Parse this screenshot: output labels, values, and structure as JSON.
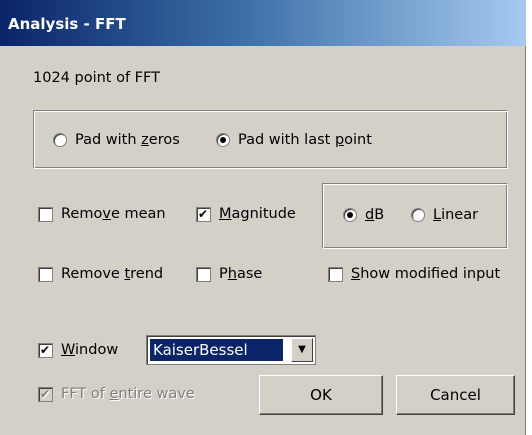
{
  "window": {
    "title": "Analysis - FFT"
  },
  "info": {
    "points_text": "1024 point of FFT"
  },
  "padding": {
    "options": [
      {
        "label_pre": "Pad with ",
        "mnemonic": "z",
        "label_post": "eros",
        "checked": false
      },
      {
        "label_pre": "Pad with last ",
        "mnemonic": "p",
        "label_post": "oint",
        "checked": true
      }
    ]
  },
  "options": {
    "remove_mean": {
      "label_pre": "Remo",
      "mnemonic": "v",
      "label_post": "e mean",
      "checked": false
    },
    "magnitude": {
      "label_pre": "",
      "mnemonic": "M",
      "label_post": "agnitude",
      "checked": true
    },
    "remove_trend": {
      "label_pre": "Remove ",
      "mnemonic": "t",
      "label_post": "rend",
      "checked": false
    },
    "phase": {
      "label_pre": "P",
      "mnemonic": "h",
      "label_post": "ase",
      "checked": false
    },
    "show_modified": {
      "label_pre": "",
      "mnemonic": "S",
      "label_post": "how modified input",
      "checked": false
    }
  },
  "scale": {
    "options": [
      {
        "label_pre": "",
        "mnemonic": "d",
        "label_post": "B",
        "checked": true
      },
      {
        "label_pre": "",
        "mnemonic": "L",
        "label_post": "inear",
        "checked": false
      }
    ]
  },
  "window_fn": {
    "label_pre": "",
    "mnemonic": "W",
    "label_post": "indow",
    "checked": true,
    "selected": "KaiserBessel"
  },
  "entire_wave": {
    "label_pre": "FFT of ",
    "mnemonic": "e",
    "label_post": "ntire wave",
    "checked": true,
    "disabled": true
  },
  "buttons": {
    "ok": "OK",
    "cancel": "Cancel"
  }
}
